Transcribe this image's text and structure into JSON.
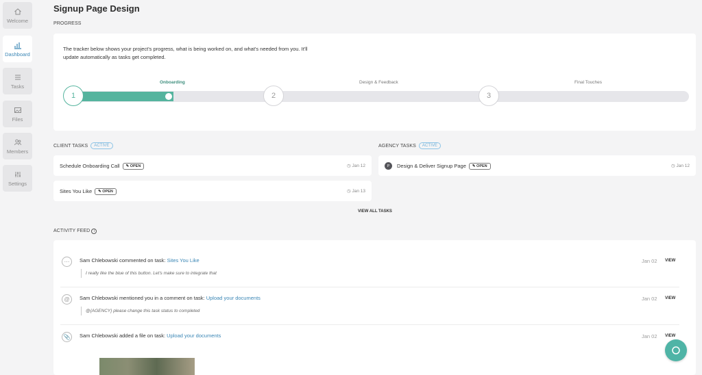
{
  "nav": [
    {
      "label": "Welcome",
      "icon": "home-icon"
    },
    {
      "label": "Dashboard",
      "icon": "bar-chart-icon"
    },
    {
      "label": "Tasks",
      "icon": "list-icon"
    },
    {
      "label": "Files",
      "icon": "image-icon"
    },
    {
      "label": "Members",
      "icon": "users-icon"
    },
    {
      "label": "Settings",
      "icon": "sliders-icon"
    }
  ],
  "page": {
    "title": "Signup Page Design"
  },
  "progress": {
    "section_label": "PROGRESS",
    "description": "The tracker below shows your project's progress, what is being worked on, and what's needed from you. It'll update automatically as tasks get completed.",
    "steps": [
      {
        "number": "1",
        "label": "Onboarding"
      },
      {
        "number": "2",
        "label": "Design & Feedback"
      },
      {
        "number": "3",
        "label": "Final Touches"
      }
    ]
  },
  "client_tasks": {
    "label": "CLIENT TASKS",
    "badge": "ACTIVE",
    "items": [
      {
        "title": "Schedule Onboarding Call",
        "status": "OPEN",
        "date": "Jan 12"
      },
      {
        "title": "Sites You Like",
        "status": "OPEN",
        "date": "Jan 13"
      }
    ]
  },
  "agency_tasks": {
    "label": "AGENCY TASKS",
    "badge": "ACTIVE",
    "items": [
      {
        "avatar": "P",
        "title": "Design & Deliver Signup Page",
        "status": "OPEN",
        "date": "Jan 12"
      }
    ]
  },
  "view_all_label": "VIEW ALL TASKS",
  "activity": {
    "label": "ACTIVITY FEED",
    "items": [
      {
        "icon": "comment-icon",
        "text": "Sam Chlebowski commented on task: ",
        "link": "Sites You Like",
        "quote": "I really like the blue of this button. Let's make sure to integrate that",
        "date": "Jan 02",
        "action": "VIEW"
      },
      {
        "icon": "at-icon",
        "text": "Sam Chlebowski mentioned you in a comment on task: ",
        "link": "Upload your documents",
        "quote": "@{AGENCY} please change this task status to completed",
        "date": "Jan 02",
        "action": "VIEW"
      },
      {
        "icon": "paperclip-icon",
        "text": "Sam Chlebowski added a file on task: ",
        "link": "Upload your documents",
        "quote": "",
        "date": "Jan 02",
        "action": "VIEW"
      }
    ]
  },
  "colors": {
    "accent": "#55b49e",
    "link": "#3a86b5",
    "chat": "#4fb4a6"
  }
}
